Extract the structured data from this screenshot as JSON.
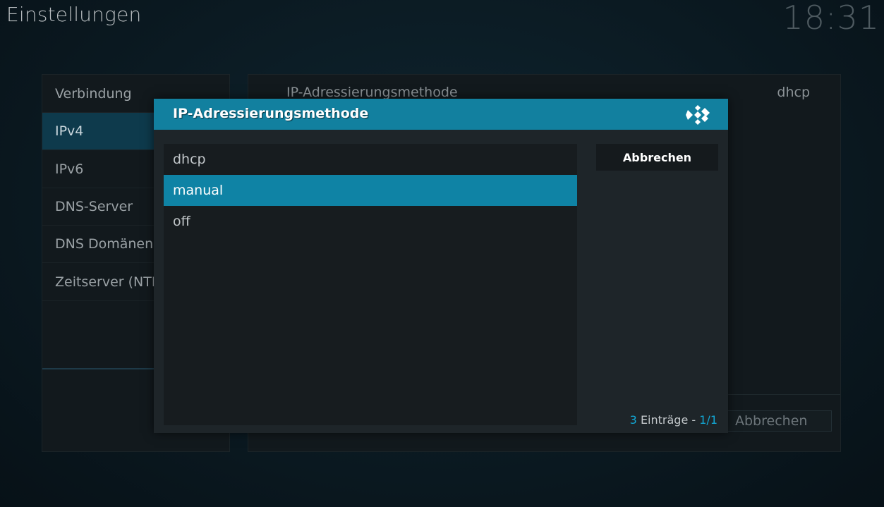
{
  "header": {
    "title": "Einstellungen",
    "clock": "18:31"
  },
  "sidebar": {
    "items": [
      {
        "label": "Verbindung"
      },
      {
        "label": "IPv4"
      },
      {
        "label": "IPv6"
      },
      {
        "label": "DNS-Server"
      },
      {
        "label": "DNS Domänen"
      },
      {
        "label": "Zeitserver (NTP"
      }
    ],
    "selected_index": 1
  },
  "main": {
    "row_label": "IP-Adressierungsmethode",
    "row_value": "dhcp",
    "cancel_label": "Abbrechen"
  },
  "dialog": {
    "title": "IP-Adressierungsmethode",
    "options": [
      "dhcp",
      "manual",
      "off"
    ],
    "focused_index": 1,
    "cancel_label": "Abbrechen",
    "entries_count": "3",
    "entries_text": "Einträge -",
    "page": "1/1"
  },
  "colors": {
    "accent": "#12809f",
    "focus": "#0f83a5",
    "count_accent": "#12a6d3"
  },
  "icons": {
    "logo": "kodi-logo-icon"
  }
}
